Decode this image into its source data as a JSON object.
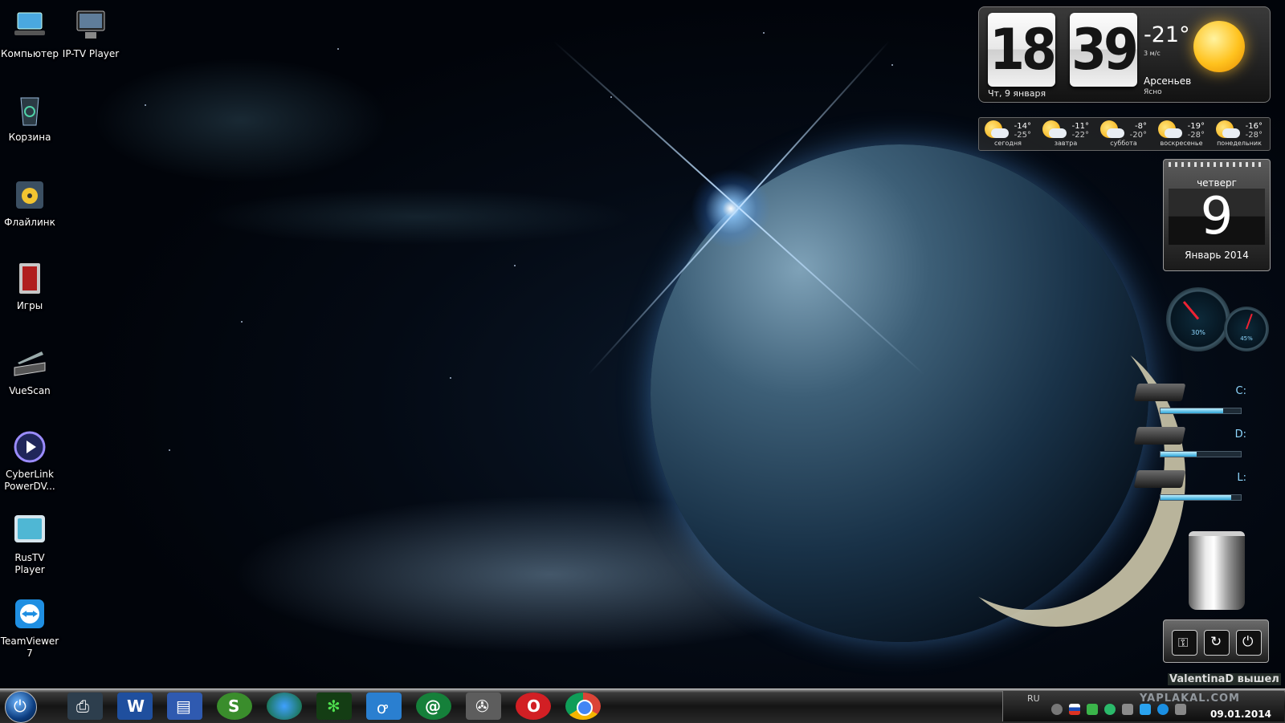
{
  "desktop": {
    "icons": [
      {
        "label": "Компьютер",
        "icon": "computer-icon"
      },
      {
        "label": "IP-TV Player",
        "icon": "tv-icon"
      },
      {
        "label": "Корзина",
        "icon": "recycle-bin-icon"
      },
      {
        "label": "Флайлинк",
        "icon": "media-icon"
      },
      {
        "label": "Игры",
        "icon": "games-icon"
      },
      {
        "label": "VueScan",
        "icon": "scanner-icon"
      },
      {
        "label": "CyberLink PowerDV...",
        "icon": "play-disc-icon"
      },
      {
        "label": "RusTV Player",
        "icon": "monitor-icon"
      },
      {
        "label": "TeamViewer 7",
        "icon": "teamviewer-icon"
      }
    ]
  },
  "clock_widget": {
    "hours": "18",
    "minutes": "39",
    "date": "Чт, 9 января",
    "temperature": "-21°",
    "wind": "3 м/с",
    "city": "Арсеньев",
    "condition": "Ясно"
  },
  "forecast": [
    {
      "hi": "-14°",
      "lo": "-25°",
      "day": "сегодня"
    },
    {
      "hi": "-11°",
      "lo": "-22°",
      "day": "завтра"
    },
    {
      "hi": "-8°",
      "lo": "-20°",
      "day": "суббота"
    },
    {
      "hi": "-19°",
      "lo": "-28°",
      "day": "воскресенье"
    },
    {
      "hi": "-16°",
      "lo": "-28°",
      "day": "понедельник"
    }
  ],
  "calendar": {
    "weekday": "четверг",
    "day": "9",
    "month_year": "Январь 2014"
  },
  "gauges": {
    "cpu": "30%",
    "ram": "45%"
  },
  "drives": [
    {
      "letter": "C:",
      "used": 0.78
    },
    {
      "letter": "D:",
      "used": 0.45
    },
    {
      "letter": "L:",
      "used": 0.88
    }
  ],
  "status_text": "ValentinaD вышел",
  "taskbar": {
    "language": "RU",
    "clock_date": "09.01.2014",
    "watermark": "YAPLAKAL.COM",
    "apps": [
      "printer-icon",
      "word-icon",
      "floppy-icon",
      "skype-icon",
      "globe-icon",
      "cannabis-icon",
      "odnoklassniki-icon",
      "mail-at-icon",
      "satellite-icon",
      "opera-icon",
      "chrome-icon"
    ]
  },
  "colors": {
    "accent": "#2ea4d6",
    "label_blue": "#8fd8ff"
  }
}
